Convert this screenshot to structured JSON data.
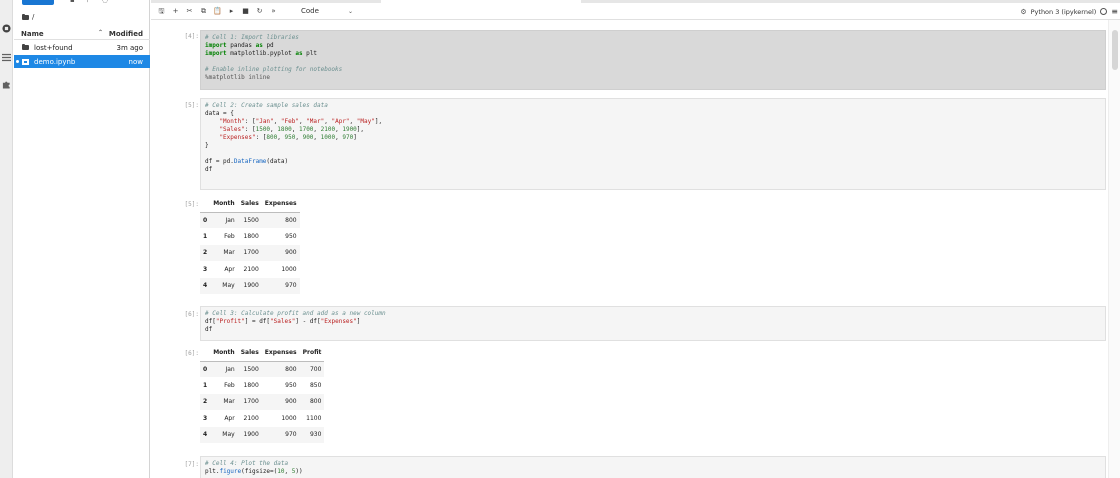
{
  "activity_bar": {
    "icons": [
      "circle-stop-icon",
      "list-icon",
      "puzzle-icon"
    ]
  },
  "file_browser": {
    "breadcrumb": "/",
    "columns": {
      "name": "Name",
      "modified": "Modified"
    },
    "files": [
      {
        "name": "lost+found",
        "modified": "3m ago",
        "type": "folder",
        "selected": false
      },
      {
        "name": "demo.ipynb",
        "modified": "now",
        "type": "notebook",
        "selected": true
      }
    ]
  },
  "toolbar": {
    "cell_type": "Code",
    "kernel": "Python 3 (ipykernel)"
  },
  "cells": [
    {
      "prompt": "[4]:",
      "lines": [
        [
          {
            "c": "cm",
            "t": "# Cell 1: Import libraries"
          }
        ],
        [
          {
            "c": "kw",
            "t": "import"
          },
          {
            "c": "nm",
            "t": " pandas "
          },
          {
            "c": "kw",
            "t": "as"
          },
          {
            "c": "nm",
            "t": " pd"
          }
        ],
        [
          {
            "c": "kw",
            "t": "import"
          },
          {
            "c": "nm",
            "t": " matplotlib.pyplot "
          },
          {
            "c": "kw",
            "t": "as"
          },
          {
            "c": "nm",
            "t": " plt"
          }
        ],
        [],
        [
          {
            "c": "cm",
            "t": "# Enable inline plotting for notebooks"
          }
        ],
        [
          {
            "c": "mg",
            "t": "%matplotlib inline"
          }
        ]
      ]
    },
    {
      "prompt": "[5]:",
      "lines": [
        [
          {
            "c": "cm",
            "t": "# Cell 2: Create sample sales data"
          }
        ],
        [
          {
            "c": "nm",
            "t": "data = {"
          }
        ],
        [
          {
            "c": "str",
            "t": "    \"Month\""
          },
          {
            "c": "nm",
            "t": ": ["
          },
          {
            "c": "str",
            "t": "\"Jan\""
          },
          {
            "c": "nm",
            "t": ", "
          },
          {
            "c": "str",
            "t": "\"Feb\""
          },
          {
            "c": "nm",
            "t": ", "
          },
          {
            "c": "str",
            "t": "\"Mar\""
          },
          {
            "c": "nm",
            "t": ", "
          },
          {
            "c": "str",
            "t": "\"Apr\""
          },
          {
            "c": "nm",
            "t": ", "
          },
          {
            "c": "str",
            "t": "\"May\""
          },
          {
            "c": "nm",
            "t": "],"
          }
        ],
        [
          {
            "c": "str",
            "t": "    \"Sales\""
          },
          {
            "c": "nm",
            "t": ": ["
          },
          {
            "c": "num",
            "t": "1500"
          },
          {
            "c": "nm",
            "t": ", "
          },
          {
            "c": "num",
            "t": "1800"
          },
          {
            "c": "nm",
            "t": ", "
          },
          {
            "c": "num",
            "t": "1700"
          },
          {
            "c": "nm",
            "t": ", "
          },
          {
            "c": "num",
            "t": "2100"
          },
          {
            "c": "nm",
            "t": ", "
          },
          {
            "c": "num",
            "t": "1900"
          },
          {
            "c": "nm",
            "t": "],"
          }
        ],
        [
          {
            "c": "str",
            "t": "    \"Expenses\""
          },
          {
            "c": "nm",
            "t": ": ["
          },
          {
            "c": "num",
            "t": "800"
          },
          {
            "c": "nm",
            "t": ", "
          },
          {
            "c": "num",
            "t": "950"
          },
          {
            "c": "nm",
            "t": ", "
          },
          {
            "c": "num",
            "t": "900"
          },
          {
            "c": "nm",
            "t": ", "
          },
          {
            "c": "num",
            "t": "1000"
          },
          {
            "c": "nm",
            "t": ", "
          },
          {
            "c": "num",
            "t": "970"
          },
          {
            "c": "nm",
            "t": "]"
          }
        ],
        [
          {
            "c": "nm",
            "t": "}"
          }
        ],
        [],
        [
          {
            "c": "nm",
            "t": "df = pd."
          },
          {
            "c": "fn",
            "t": "DataFrame"
          },
          {
            "c": "nm",
            "t": "(data)"
          }
        ],
        [
          {
            "c": "nm",
            "t": "df"
          }
        ]
      ]
    },
    {
      "prompt": "[6]:",
      "lines": [
        [
          {
            "c": "cm",
            "t": "# Cell 3: Calculate profit and add as a new column"
          }
        ],
        [
          {
            "c": "nm",
            "t": "df["
          },
          {
            "c": "str",
            "t": "\"Profit\""
          },
          {
            "c": "nm",
            "t": "] = df["
          },
          {
            "c": "str",
            "t": "\"Sales\""
          },
          {
            "c": "nm",
            "t": "] - df["
          },
          {
            "c": "str",
            "t": "\"Expenses\""
          },
          {
            "c": "nm",
            "t": "]"
          }
        ],
        [
          {
            "c": "nm",
            "t": "df"
          }
        ]
      ]
    },
    {
      "prompt": "[7]:",
      "lines": [
        [
          {
            "c": "cm",
            "t": "# Cell 4: Plot the data"
          }
        ],
        [
          {
            "c": "nm",
            "t": "plt."
          },
          {
            "c": "fn",
            "t": "figure"
          },
          {
            "c": "nm",
            "t": "(figsize=("
          },
          {
            "c": "num",
            "t": "10"
          },
          {
            "c": "nm",
            "t": ", "
          },
          {
            "c": "num",
            "t": "5"
          },
          {
            "c": "nm",
            "t": "))"
          }
        ]
      ]
    }
  ],
  "outputs": [
    {
      "prompt": "[5]:",
      "columns": [
        "",
        "Month",
        "Sales",
        "Expenses"
      ],
      "rows": [
        [
          "0",
          "Jan",
          "1500",
          "800"
        ],
        [
          "1",
          "Feb",
          "1800",
          "950"
        ],
        [
          "2",
          "Mar",
          "1700",
          "900"
        ],
        [
          "3",
          "Apr",
          "2100",
          "1000"
        ],
        [
          "4",
          "May",
          "1900",
          "970"
        ]
      ]
    },
    {
      "prompt": "[6]:",
      "columns": [
        "",
        "Month",
        "Sales",
        "Expenses",
        "Profit"
      ],
      "rows": [
        [
          "0",
          "Jan",
          "1500",
          "800",
          "700"
        ],
        [
          "1",
          "Feb",
          "1800",
          "950",
          "850"
        ],
        [
          "2",
          "Mar",
          "1700",
          "900",
          "800"
        ],
        [
          "3",
          "Apr",
          "2100",
          "1000",
          "1100"
        ],
        [
          "4",
          "May",
          "1900",
          "970",
          "930"
        ]
      ]
    }
  ],
  "colors": {
    "accent": "#1e88e5",
    "selected_cell": "#d9d9d9"
  }
}
